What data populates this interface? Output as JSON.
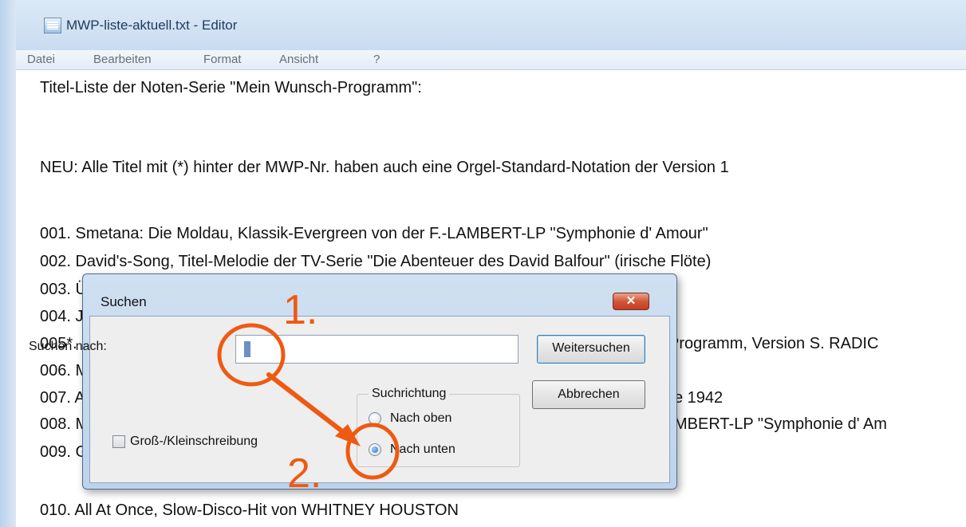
{
  "window": {
    "title": "MWP-liste-aktuell.txt - Editor"
  },
  "menu": {
    "items": [
      "Datei",
      "Bearbeiten",
      "Format",
      "Ansicht",
      "?"
    ]
  },
  "editor": {
    "lines": [
      "Titel-Liste der Noten-Serie \"Mein Wunsch-Programm\":",
      "NEU: Alle Titel mit (*) hinter der MWP-Nr. haben auch eine Orgel-Standard-Notation der Version 1",
      "001. Smetana: Die Moldau, Klassik-Evergreen von der F.-LAMBERT-LP \"Symphonie d' Amour\"",
      "002. David's-Song, Titel-Melodie der TV-Serie \"Die Abenteuer des David Balfour\" (irische Flöte)",
      "003. Ü",
      "004. J'",
      "005*. F",
      "006. M",
      "007. A",
      "008. M",
      "009. G",
      "010. All At Once, Slow-Disco-Hit von WHITNEY HOUSTON"
    ],
    "partial_right": {
      "line_005": "Programm, Version S. RADIC",
      "line_007": "e 1942",
      "line_008": "MBERT-LP \"Symphonie d' Am"
    }
  },
  "dialog": {
    "title": "Suchen",
    "close_label": "✕",
    "search_label": "Suchen nach:",
    "search_value": "",
    "find_next_label": "Weitersuchen",
    "cancel_label": "Abbrechen",
    "direction_legend": "Suchrichtung",
    "direction_up_label": "Nach oben",
    "direction_down_label": "Nach unten",
    "direction_selected": "down",
    "case_label": "Groß-/Kleinschreibung",
    "case_checked": false
  },
  "annotations": {
    "step1": "1.",
    "step2": "2.",
    "color": "#ee5a12"
  }
}
